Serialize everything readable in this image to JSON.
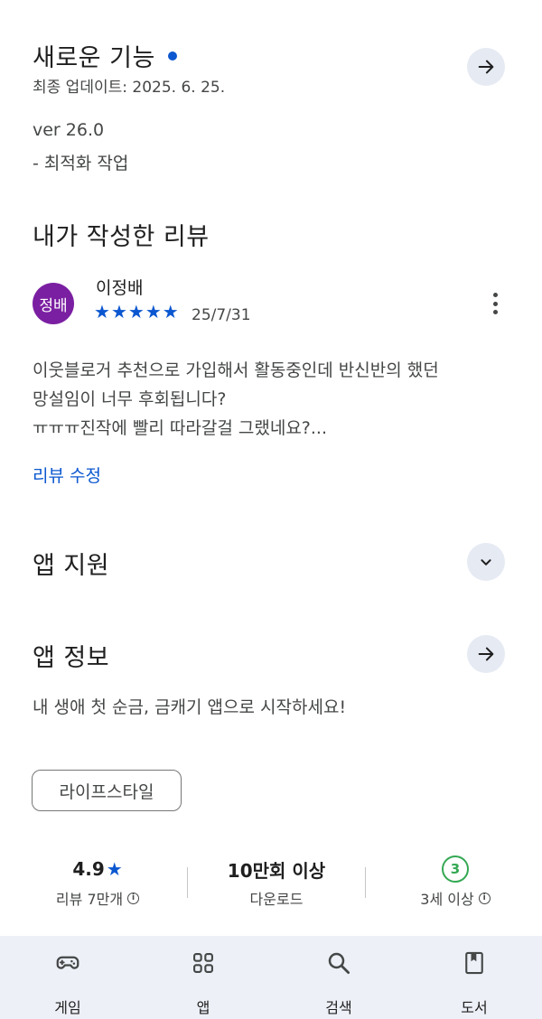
{
  "whats_new": {
    "title": "새로운 기능",
    "updated": "최종 업데이트: 2025. 6. 25.",
    "version": "ver 26.0",
    "note": "- 최적화 작업"
  },
  "my_review": {
    "title": "내가 작성한 리뷰",
    "avatar_text": "정배",
    "reviewer": "이정배",
    "stars": 5,
    "date": "25/7/31",
    "text_lines": [
      "이웃블로거 추천으로 가입해서 활동중인데 반신반의 했던",
      "망설임이 너무 후회됩니다?",
      "ㅠㅠㅠ진작에 빨리 따라갈걸 그랬네요?..."
    ],
    "edit_label": "리뷰 수정"
  },
  "app_support": {
    "title": "앱 지원"
  },
  "app_info": {
    "title": "앱 정보",
    "description": "내 생애 첫 순금, 금캐기 앱으로 시작하세요!",
    "category": "라이프스타일"
  },
  "stats": {
    "rating": "4.9",
    "reviews": "리뷰 7만개",
    "downloads": "10만회 이상",
    "downloads_label": "다운로드",
    "age_badge": "3",
    "age_label": "3세 이상"
  },
  "nav": [
    {
      "label": "게임",
      "icon": "gamepad-icon"
    },
    {
      "label": "앱",
      "icon": "apps-grid-icon"
    },
    {
      "label": "검색",
      "icon": "search-icon"
    },
    {
      "label": "도서",
      "icon": "book-icon"
    }
  ],
  "colors": {
    "accent": "#0b57d0",
    "avatar": "#7b1fa2",
    "age_badge": "#34a853",
    "nav_bg": "#edf0f7"
  }
}
